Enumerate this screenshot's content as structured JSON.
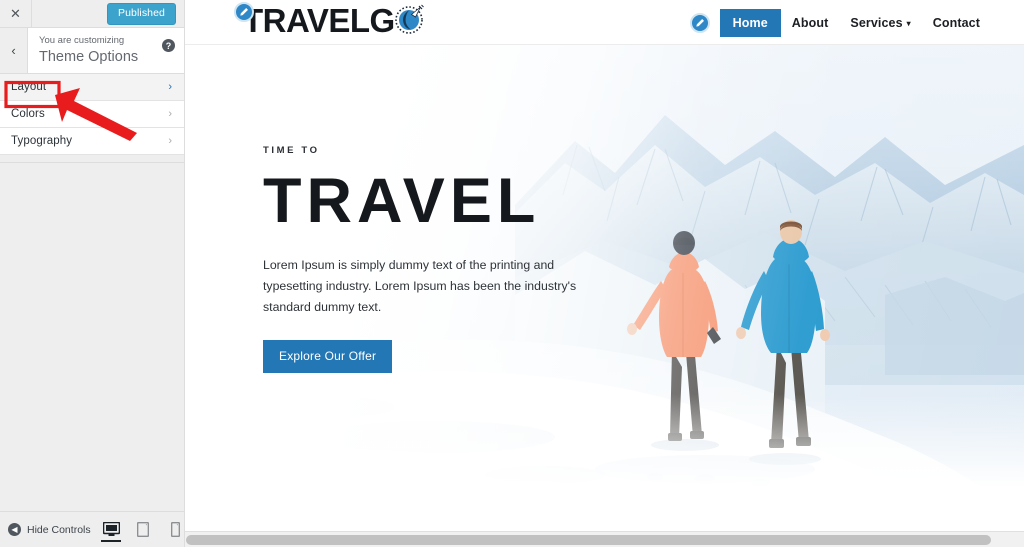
{
  "customizer": {
    "close_label": "✕",
    "publish_label": "Published",
    "back_label": "‹",
    "eyebrow": "You are customizing",
    "panel_title": "Theme Options",
    "help_label": "?",
    "sections": [
      {
        "label": "Layout",
        "chevron": "›",
        "state": "hover"
      },
      {
        "label": "Colors",
        "chevron": "›",
        "state": "normal"
      },
      {
        "label": "Typography",
        "chevron": "›",
        "state": "normal"
      }
    ],
    "footer": {
      "hide_controls_label": "Hide Controls",
      "hide_icon_glyph": "◀",
      "devices": [
        {
          "name": "desktop",
          "active": true
        },
        {
          "name": "tablet",
          "active": false
        },
        {
          "name": "mobile",
          "active": false
        }
      ]
    }
  },
  "site": {
    "logo_text": "TRAVELG",
    "nav": [
      {
        "label": "Home",
        "active": true,
        "has_dropdown": false
      },
      {
        "label": "About",
        "active": false,
        "has_dropdown": false
      },
      {
        "label": "Services",
        "active": false,
        "has_dropdown": true,
        "caret": "▾"
      },
      {
        "label": "Contact",
        "active": false,
        "has_dropdown": false
      }
    ],
    "hero": {
      "eyebrow": "TIME TO",
      "title": "TRAVEL",
      "paragraph": "Lorem Ipsum is simply dummy text of the printing and typesetting industry. Lorem Ipsum has been the industry's standard dummy text.",
      "button_label": "Explore Our Offer",
      "image_alt": "Two hikers in orange and blue jackets walking on a snowy mountain ridge"
    }
  },
  "colors": {
    "publish_blue": "#3ca3cc",
    "nav_active_blue": "#2477b5",
    "button_blue": "#2477b5",
    "annotation_red": "#e81c1c",
    "sidebar_bg": "#eeeeee"
  }
}
